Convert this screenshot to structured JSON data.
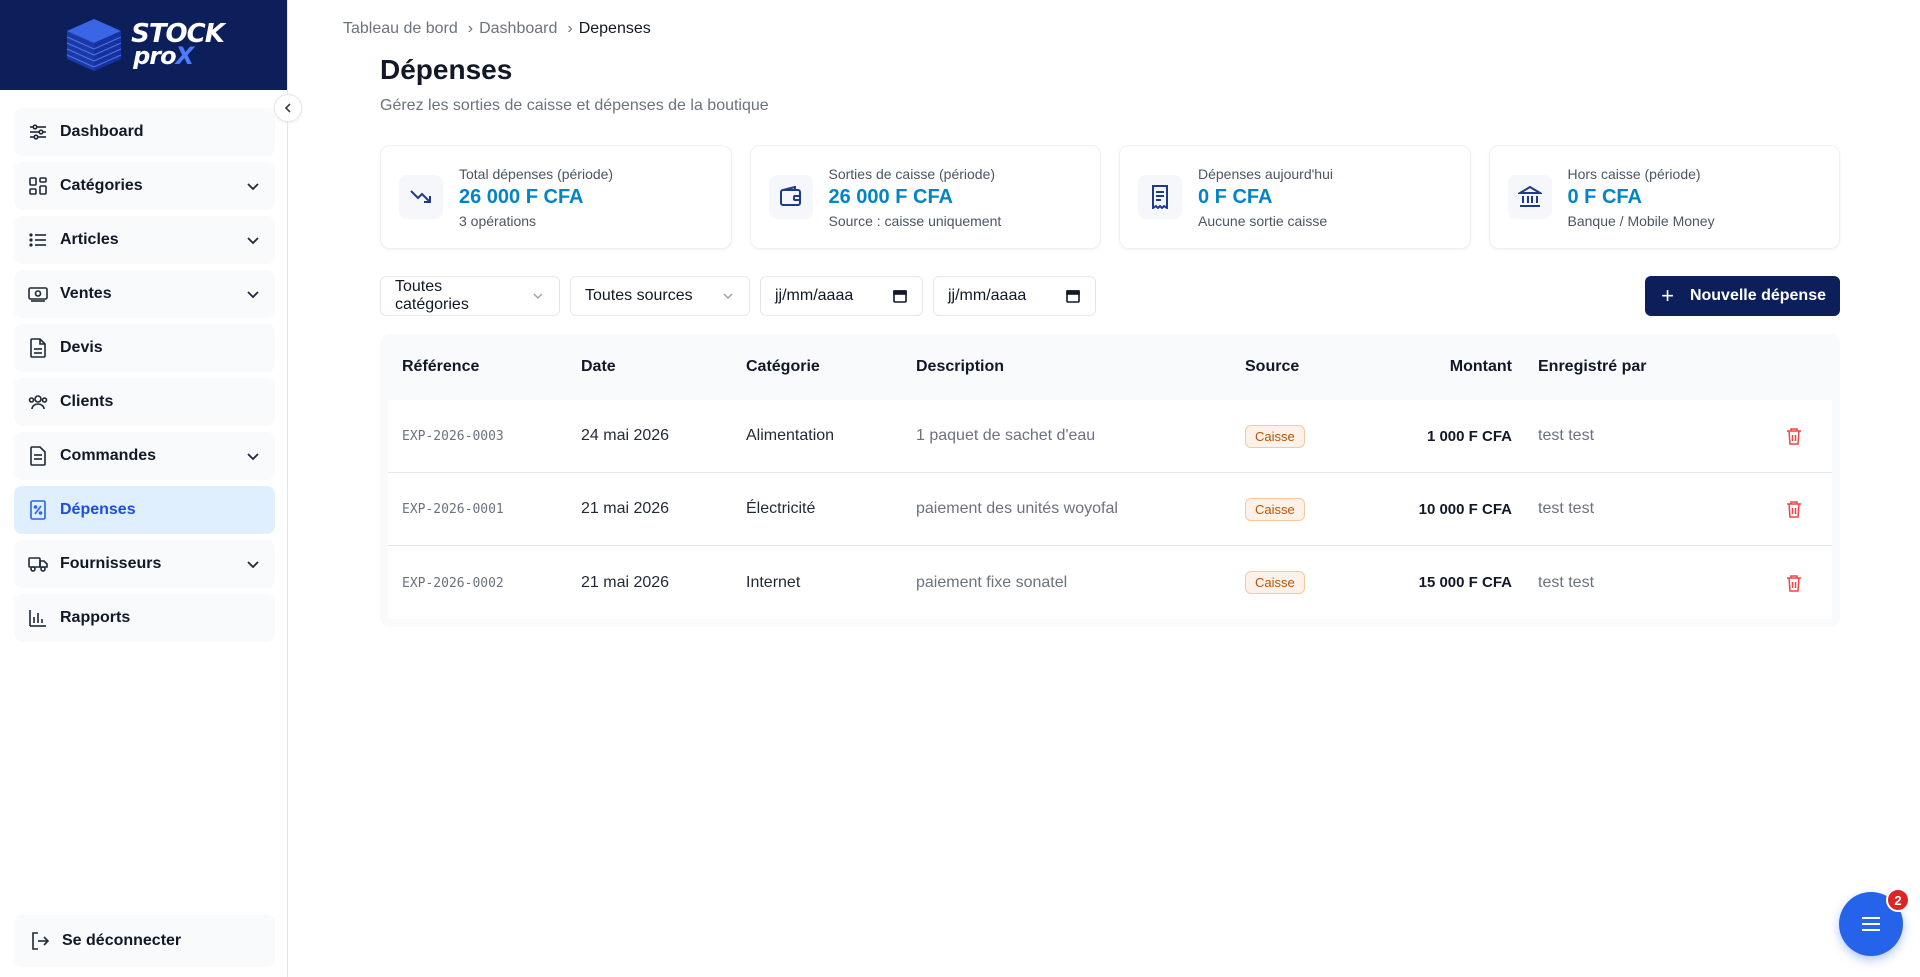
{
  "brand": {
    "line1": "STOCK",
    "line2_a": "pro",
    "line2_b": "X"
  },
  "sidebar": {
    "items": [
      {
        "label": "Dashboard",
        "icon": "sliders-icon",
        "has_chevron": false
      },
      {
        "label": "Catégories",
        "icon": "grid-icon",
        "has_chevron": true
      },
      {
        "label": "Articles",
        "icon": "list-icon",
        "has_chevron": true
      },
      {
        "label": "Ventes",
        "icon": "cash-icon",
        "has_chevron": true
      },
      {
        "label": "Devis",
        "icon": "document-icon",
        "has_chevron": false
      },
      {
        "label": "Clients",
        "icon": "users-icon",
        "has_chevron": false
      },
      {
        "label": "Commandes",
        "icon": "clipboard-icon",
        "has_chevron": true
      },
      {
        "label": "Dépenses",
        "icon": "receipt-icon",
        "has_chevron": false,
        "active": true
      },
      {
        "label": "Fournisseurs",
        "icon": "truck-icon",
        "has_chevron": true
      },
      {
        "label": "Rapports",
        "icon": "bar-chart-icon",
        "has_chevron": false
      }
    ],
    "logout_label": "Se déconnecter"
  },
  "breadcrumb": [
    "Tableau de bord",
    "Dashboard",
    "Depenses"
  ],
  "page": {
    "title": "Dépenses",
    "subtitle": "Gérez les sorties de caisse et dépenses de la boutique"
  },
  "cards": [
    {
      "label": "Total dépenses (période)",
      "value": "26 000 F CFA",
      "note": "3 opérations",
      "icon": "trending-down-icon"
    },
    {
      "label": "Sorties de caisse (période)",
      "value": "26 000 F CFA",
      "note": "Source : caisse uniquement",
      "icon": "wallet-icon"
    },
    {
      "label": "Dépenses aujourd'hui",
      "value": "0 F CFA",
      "note": "Aucune sortie caisse",
      "icon": "receipt-icon"
    },
    {
      "label": "Hors caisse (période)",
      "value": "0 F CFA",
      "note": "Banque / Mobile Money",
      "icon": "bank-icon"
    }
  ],
  "filters": {
    "category": "Toutes catégories",
    "source": "Toutes sources",
    "date_from": "jj/mm/aaaa",
    "date_to": "jj/mm/aaaa",
    "new_label": "Nouvelle dépense"
  },
  "table": {
    "headers": [
      "Référence",
      "Date",
      "Catégorie",
      "Description",
      "Source",
      "Montant",
      "Enregistré par"
    ],
    "rows": [
      {
        "ref": "EXP-2026-0003",
        "date": "24 mai 2026",
        "category": "Alimentation",
        "description": "1 paquet de sachet d'eau",
        "source": "Caisse",
        "amount": "1 000 F CFA",
        "by": "test test"
      },
      {
        "ref": "EXP-2026-0001",
        "date": "21 mai 2026",
        "category": "Électricité",
        "description": "paiement des unités woyofal",
        "source": "Caisse",
        "amount": "10 000 F CFA",
        "by": "test test"
      },
      {
        "ref": "EXP-2026-0002",
        "date": "21 mai 2026",
        "category": "Internet",
        "description": "paiement fixe sonatel",
        "source": "Caisse",
        "amount": "15 000 F CFA",
        "by": "test test"
      }
    ]
  },
  "fab": {
    "badge": "2"
  },
  "colors": {
    "brand": "#0c1f5a",
    "accent": "#2563eb",
    "value": "#0284c7",
    "danger": "#ef4444"
  }
}
